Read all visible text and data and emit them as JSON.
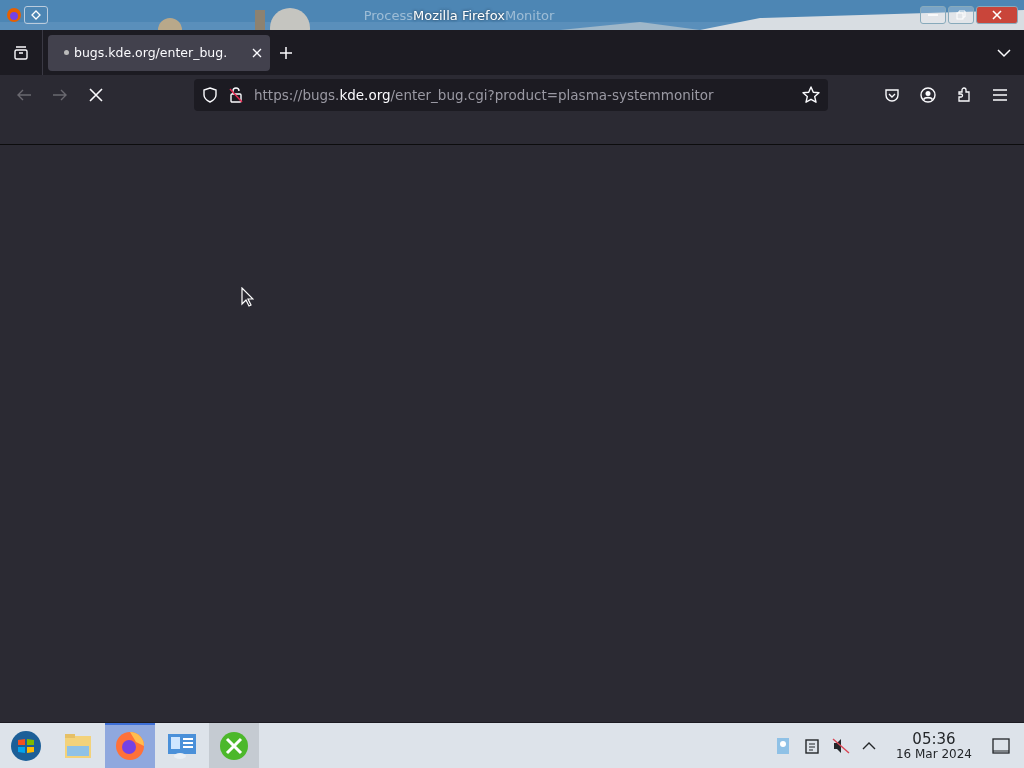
{
  "window": {
    "title": "Mozilla Firefox",
    "background_title": [
      "Process",
      "Monitor"
    ]
  },
  "tabs": [
    {
      "label": "bugs.kde.org/enter_bug.",
      "selected": true,
      "loading": true
    }
  ],
  "navigation": {
    "back_disabled": true,
    "forward_disabled": true,
    "loading": true
  },
  "address": {
    "prefix": "https://bugs.",
    "domain": "kde.org",
    "path": "/enter_bug.cgi?product=plasma-systemmonitor"
  },
  "taskbar": {
    "apps": [
      {
        "kind": "start",
        "selected": false
      },
      {
        "kind": "files",
        "selected": false
      },
      {
        "kind": "firefox",
        "selected": true
      },
      {
        "kind": "monitor",
        "selected": false
      },
      {
        "kind": "tools",
        "selected": false
      }
    ],
    "clock": {
      "time": "05:36",
      "date": "16 Mar 2024"
    }
  }
}
